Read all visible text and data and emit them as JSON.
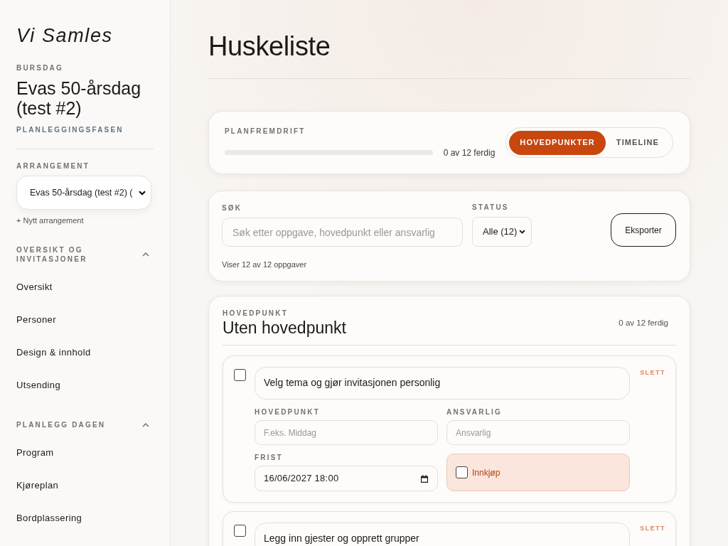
{
  "sidebar": {
    "brand": "Vi Samles",
    "event_type": "BURSDAG",
    "event_title": "Evas 50-årsdag (test #2)",
    "phase": "PLANLEGGINGSFASEN",
    "event_select": {
      "label": "ARRANGEMENT",
      "value": "Evas 50-årsdag (test #2) ("
    },
    "new_event_link": "+ Nytt arrangement",
    "sections": [
      {
        "title": "OVERSIKT OG INVITASJONER",
        "expanded": true,
        "items": [
          {
            "label": "Oversikt",
            "selected": false
          },
          {
            "label": "Personer",
            "selected": false
          },
          {
            "label": "Design & innhold",
            "selected": false
          },
          {
            "label": "Utsending",
            "selected": false
          }
        ]
      },
      {
        "title": "PLANLEGG DAGEN",
        "expanded": true,
        "items": [
          {
            "label": "Program",
            "selected": false
          },
          {
            "label": "Kjøreplan",
            "selected": false
          },
          {
            "label": "Bordplassering",
            "selected": false
          }
        ]
      }
    ]
  },
  "page_title": "Huskeliste",
  "progress_card": {
    "label": "PLANFREMDRIFT",
    "level": 0,
    "reading": "0 av 12 ferdig",
    "view_tabs": [
      {
        "label": "HOVEDPUNKTER",
        "selected": true
      },
      {
        "label": "TIMELINE",
        "selected": false
      }
    ]
  },
  "filter_card": {
    "search": {
      "label": "SØK",
      "placeholder": "Søk etter oppgave, hovedpunkt eller ansvarlig"
    },
    "status": {
      "label": "STATUS",
      "value": "Alle (12)"
    },
    "export_button": "Eksporter",
    "result_count": "Viser 12 av 12 oppgaver"
  },
  "groups": [
    {
      "eyebrow": "HOVEDPUNKT",
      "title": "Uten hovedpunkt",
      "count": "0 av 12 ferdig",
      "tasks": [
        {
          "done": false,
          "title": "Velg tema og gjør invitasjonen personlig",
          "delete": "SLETT",
          "details": {
            "category": {
              "label": "HOVEDPUNKT",
              "placeholder": "F.eks. Middag"
            },
            "owner": {
              "label": "ANSVARLIG",
              "placeholder": "Ansvarlig"
            },
            "deadline": {
              "label": "FRIST",
              "value": "16/06/2027 18:00"
            },
            "purchase": {
              "label": "Innkjøp",
              "checked": false
            }
          }
        },
        {
          "done": false,
          "title": "Legg inn gjester og opprett grupper",
          "delete": "SLETT"
        }
      ]
    }
  ]
}
